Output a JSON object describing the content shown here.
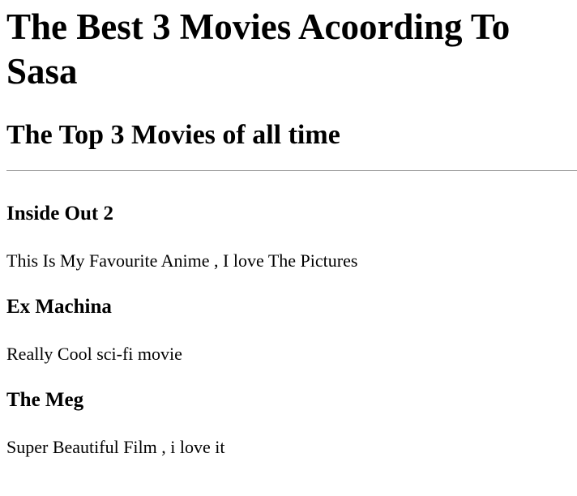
{
  "header": {
    "title": "The Best 3 Movies Acoording To Sasa",
    "subtitle": "The Top 3 Movies of all time"
  },
  "movies": [
    {
      "title": "Inside Out 2",
      "description": "This Is My Favourite Anime , I love The Pictures"
    },
    {
      "title": "Ex Machina",
      "description": "Really Cool sci-fi movie"
    },
    {
      "title": "The Meg",
      "description": "Super Beautiful Film , i love it"
    }
  ]
}
